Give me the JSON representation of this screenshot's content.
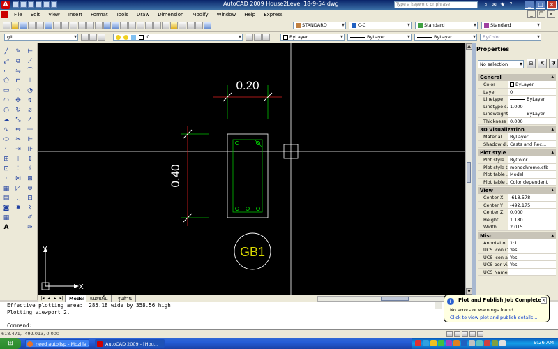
{
  "window": {
    "title": "AutoCAD 2009  House2Level 18-9-54.dwg",
    "search_placeholder": "Type a keyword or phrase"
  },
  "menu": [
    "File",
    "Edit",
    "View",
    "Insert",
    "Format",
    "Tools",
    "Draw",
    "Dimension",
    "Modify",
    "Window",
    "Help",
    "Express"
  ],
  "toolbar": {
    "text_style": "STANDARD",
    "dim_style": "C-C",
    "table_style": "Standard",
    "multileader_style": "Standard",
    "workspace": "git",
    "layer": "0",
    "color": "ByLayer",
    "linetype": "ByLayer",
    "lineweight": "ByLayer",
    "plot_style": "ByColor"
  },
  "drawing": {
    "dim_width": "0.20",
    "dim_height": "0.40",
    "tag": "GB1",
    "ucs_x": "X",
    "ucs_y": "Y"
  },
  "layout_tabs": [
    "Model",
    "แปลนพื้น",
    "รูปด้าน"
  ],
  "properties": {
    "title": "Properties",
    "selection": "No selection",
    "sections": [
      {
        "name": "General",
        "rows": [
          {
            "k": "Color",
            "v": "ByLayer",
            "swatch": true
          },
          {
            "k": "Layer",
            "v": "0"
          },
          {
            "k": "Linetype",
            "v": "ByLayer",
            "line": true
          },
          {
            "k": "Linetype s...",
            "v": "1.000"
          },
          {
            "k": "Lineweight",
            "v": "ByLayer",
            "line": true
          },
          {
            "k": "Thickness",
            "v": "0.000"
          }
        ]
      },
      {
        "name": "3D Visualization",
        "rows": [
          {
            "k": "Material",
            "v": "ByLayer"
          },
          {
            "k": "Shadow di...",
            "v": "Casts and Rec..."
          }
        ]
      },
      {
        "name": "Plot style",
        "rows": [
          {
            "k": "Plot style",
            "v": "ByColor"
          },
          {
            "k": "Plot style t...",
            "v": "monochrome.ctb"
          },
          {
            "k": "Plot table ...",
            "v": "Model"
          },
          {
            "k": "Plot table ...",
            "v": "Color dependent"
          }
        ]
      },
      {
        "name": "View",
        "rows": [
          {
            "k": "Center X",
            "v": "-618.578"
          },
          {
            "k": "Center Y",
            "v": "-492.175"
          },
          {
            "k": "Center Z",
            "v": "0.000"
          },
          {
            "k": "Height",
            "v": "1.180"
          },
          {
            "k": "Width",
            "v": "2.015"
          }
        ]
      },
      {
        "name": "Misc",
        "rows": [
          {
            "k": "Annotatio...",
            "v": "1:1"
          },
          {
            "k": "UCS icon On",
            "v": "Yes"
          },
          {
            "k": "UCS icon a...",
            "v": "Yes"
          },
          {
            "k": "UCS per vi...",
            "v": "Yes"
          },
          {
            "k": "UCS Name",
            "v": ""
          }
        ]
      }
    ]
  },
  "command": {
    "line1": "Effective plotting area:  285.18 wide by 358.56 high",
    "line2": "Plotting viewport 2.",
    "prompt": "Command:"
  },
  "status": {
    "coords": "618.471, -492.013, 0.000"
  },
  "balloon": {
    "title": "Plot and Publish Job Complete",
    "line1": "No errors or warnings found",
    "link": "Click to view plot and publish details..."
  },
  "taskbar": {
    "tasks": [
      "need autolisp - Mozilla ...",
      "AutoCAD 2009 - [Hou..."
    ],
    "clock": "9:26 AM"
  },
  "colors": {
    "canvas": "#000000",
    "crosshair": "#ffffff",
    "dim_green": "#00c000",
    "dim_red": "#e02020",
    "titlebar": "#0a246a"
  }
}
